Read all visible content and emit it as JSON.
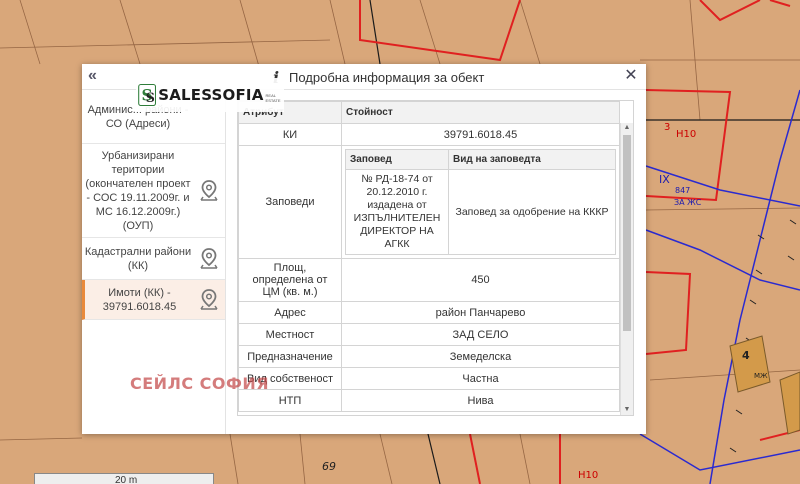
{
  "dialog": {
    "title": "Подробна информация за обект",
    "collapse_glyph": "«",
    "close_glyph": "✕"
  },
  "logo": {
    "name": "SALESSOFIA",
    "tagline": "REAL ESTATE"
  },
  "watermark": "СЕЙЛС СОФИЯ",
  "sidebar": {
    "items": [
      {
        "label": "Административни райони - СО (Адреси)",
        "label_visible": "Админис... райони - СО (Адреси)",
        "icon": "map-pin-icon"
      },
      {
        "label": "Урбанизирани територии (окончателен проект - СОС 19.11.2009г. и МС 16.12.2009г.) (ОУП)",
        "icon": "map-pin-icon"
      },
      {
        "label": "Кадастрални райони (КК)",
        "icon": "map-pin-icon"
      },
      {
        "label": "Имоти (КК) - 39791.6018.45",
        "icon": "map-pin-icon",
        "active": true
      }
    ]
  },
  "table": {
    "col_key_header": "Атрибут",
    "col_value_header": "Стойност",
    "rows": {
      "ki_label": "КИ",
      "ki_value": "39791.6018.45",
      "orders_label": "Заповеди",
      "orders_inner": {
        "h1": "Заповед",
        "h2": "Вид на заповедта",
        "c1": "№ РД-18-74 от 20.12.2010 г. издадена от ИЗПЪЛНИТЕЛЕН ДИРЕКТОР НА АГКК",
        "c2": "Заповед за одобрение на КККР"
      },
      "area_label": "Площ, определена от ЦМ (кв. м.)",
      "area_value": "450",
      "address_label": "Адрес",
      "address_value": "район Панчарево",
      "locality_label": "Местност",
      "locality_value": "ЗАД СЕЛО",
      "purpose_label": "Предназначение",
      "purpose_value": "Земеделска",
      "ownership_label": "Вид собственост",
      "ownership_value": "Частна",
      "ntp_label": "НТП",
      "ntp_value": "Нива"
    }
  },
  "map": {
    "labels": {
      "parcel_3": "3",
      "h10_a": "Н10",
      "roman_ix": "IX",
      "num_847": "847",
      "za_zhs": "ЗА ЖС",
      "num_4": "4",
      "mzh": "МЖ",
      "num_69": "69",
      "h10_b": "Н10"
    },
    "scale": "20 m",
    "colors": {
      "background": "#d9a77a",
      "parcel_red": "#e02020",
      "boundary_blue": "#2a2ad0",
      "building": "#d39a4a"
    }
  }
}
